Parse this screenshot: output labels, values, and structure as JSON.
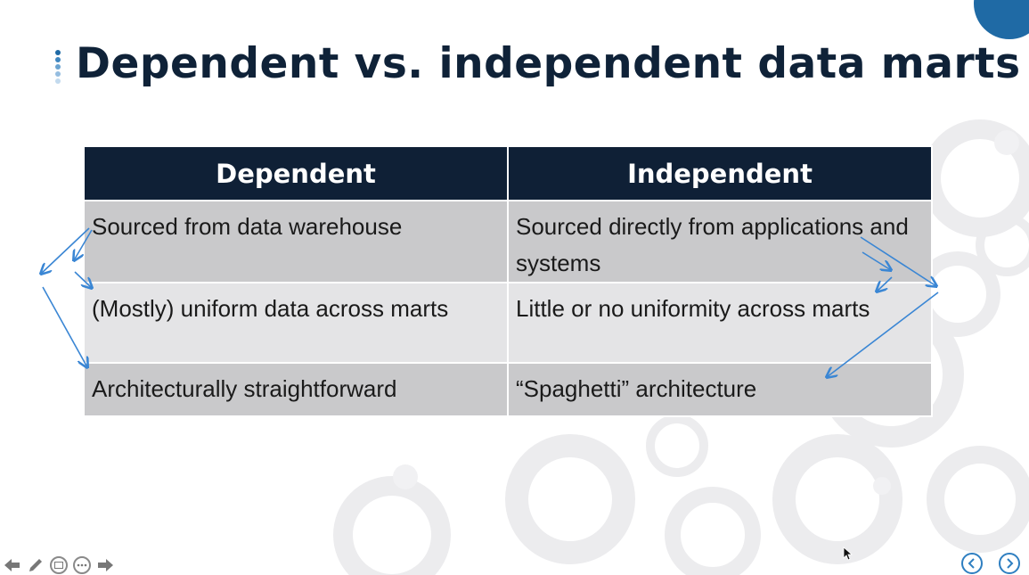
{
  "slide": {
    "title": "Dependent vs. independent data marts"
  },
  "table": {
    "headers": [
      "Dependent",
      "Independent"
    ],
    "rows": [
      [
        "Sourced from data warehouse",
        "Sourced directly from applications and systems"
      ],
      [
        "(Mostly) uniform data across marts",
        "Little or no uniformity across marts"
      ],
      [
        "Architecturally straightforward",
        "“Spaghetti” architecture"
      ]
    ]
  },
  "colors": {
    "header_bg": "#0f2036",
    "row_dark": "#c9c9cb",
    "row_light": "#e4e4e6",
    "accent": "#1f6aa5",
    "arrow": "#3a86d4"
  },
  "toolbar": {
    "left_icons": [
      "back-arrow-icon",
      "pen-icon",
      "slides-icon",
      "more-icon",
      "forward-arrow-icon"
    ],
    "right_icons": [
      "previous-slide-icon",
      "next-slide-icon"
    ]
  }
}
